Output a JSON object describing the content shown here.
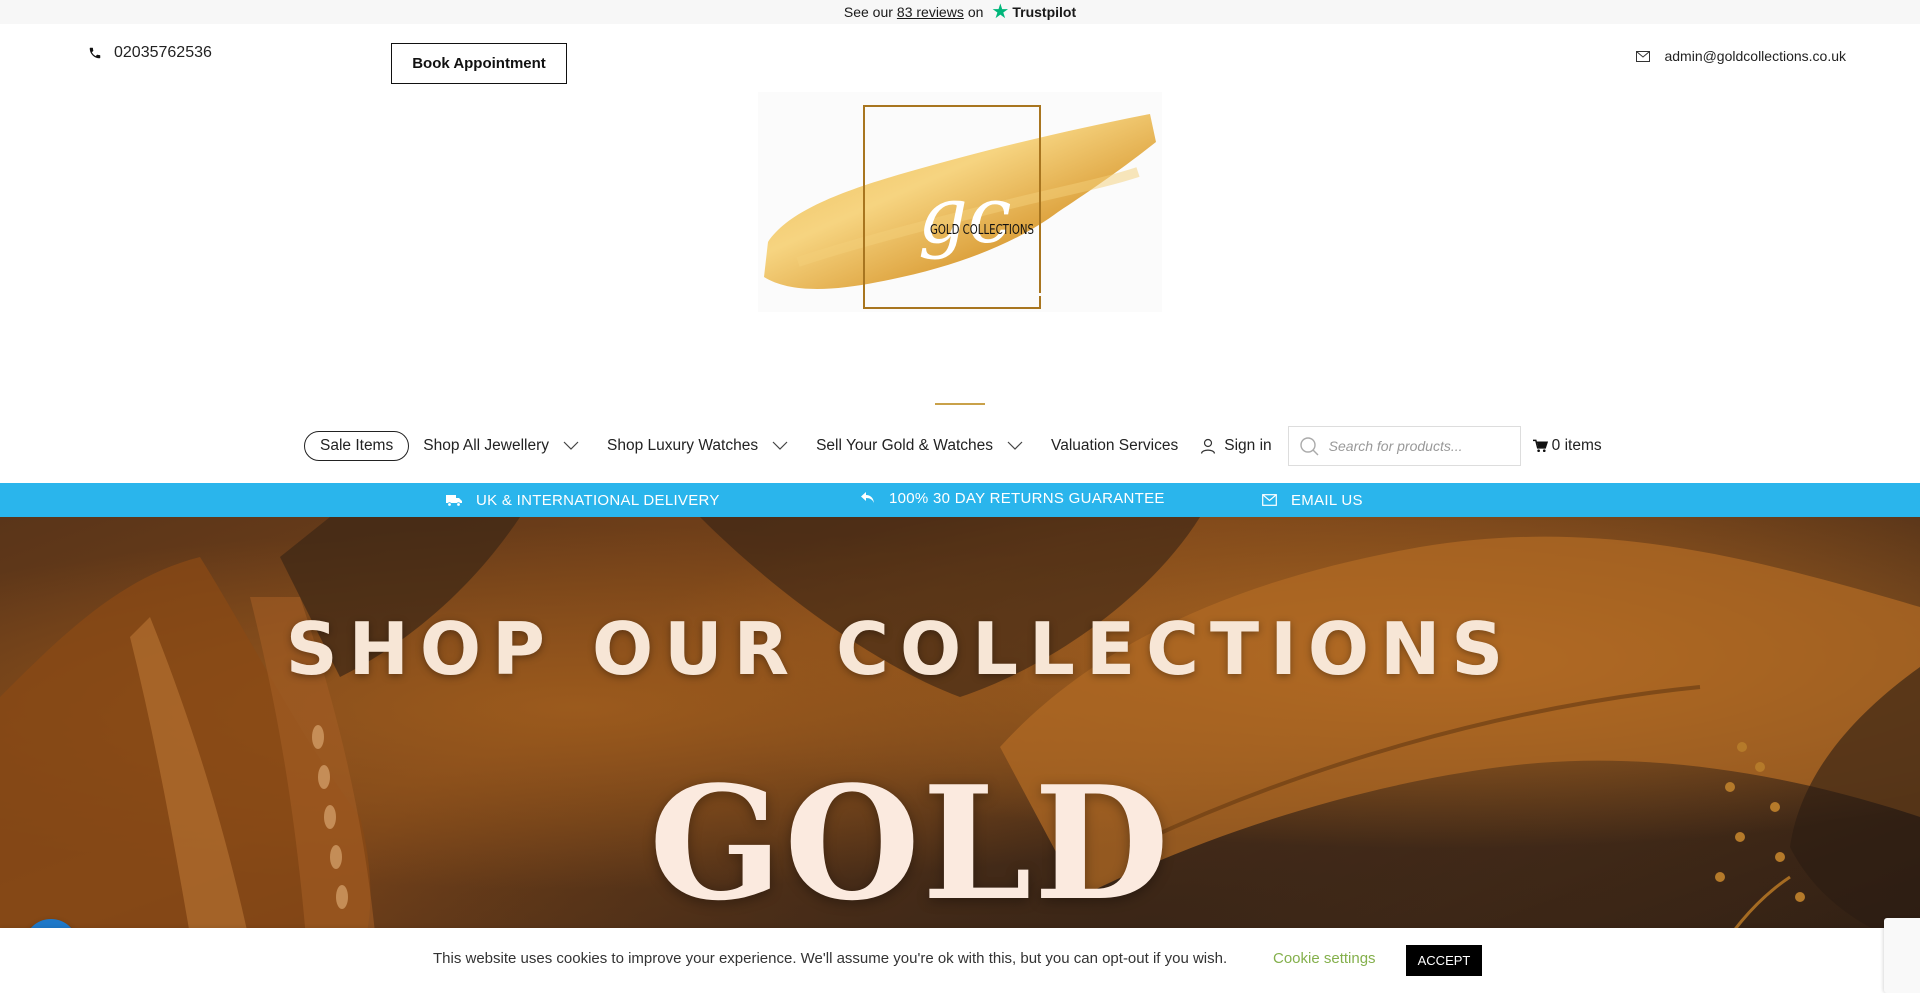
{
  "trustpilot": {
    "prefix": "See our",
    "count": "83 reviews",
    "suffix": "on",
    "brand": "Trustpilot",
    "star_color": "#00b67a"
  },
  "contact": {
    "phone": "02035762536",
    "email": "admin@goldcollections.co.uk"
  },
  "header": {
    "book_label": "Book Appointment"
  },
  "logo": {
    "monogram": "gc",
    "brand": "GOLD COLLECTIONS"
  },
  "nav": {
    "sale_label": "Sale Items",
    "items": [
      {
        "label": "Shop All Jewellery",
        "has_dropdown": true
      },
      {
        "label": "Shop Luxury Watches",
        "has_dropdown": true
      },
      {
        "label": "Sell Your Gold & Watches",
        "has_dropdown": true
      },
      {
        "label": "Valuation Services",
        "has_dropdown": false
      }
    ],
    "signin_label": "Sign in",
    "search_placeholder": "Search for products...",
    "cart_label": "0 items",
    "accent_color": "#c9a14a"
  },
  "features": {
    "bar_color": "#2ab5ec",
    "delivery": "UK & INTERNATIONAL DELIVERY",
    "returns": "100% 30 DAY RETURNS GUARANTEE",
    "email": "EMAIL US"
  },
  "hero": {
    "subtitle": "SHOP OUR COLLECTIONS",
    "title": "GOLD"
  },
  "cookie": {
    "text": "This website uses cookies to improve your experience. We'll assume you're ok with this, but you can opt-out if you wish.",
    "settings_label": "Cookie settings",
    "accept_label": "ACCEPT",
    "settings_color": "#84b04c"
  },
  "icons": [
    "phone-icon",
    "envelope-icon",
    "chevron-down-icon",
    "user-icon",
    "search-icon",
    "cart-icon",
    "truck-icon",
    "return-arrow-icon",
    "chat-icon"
  ]
}
